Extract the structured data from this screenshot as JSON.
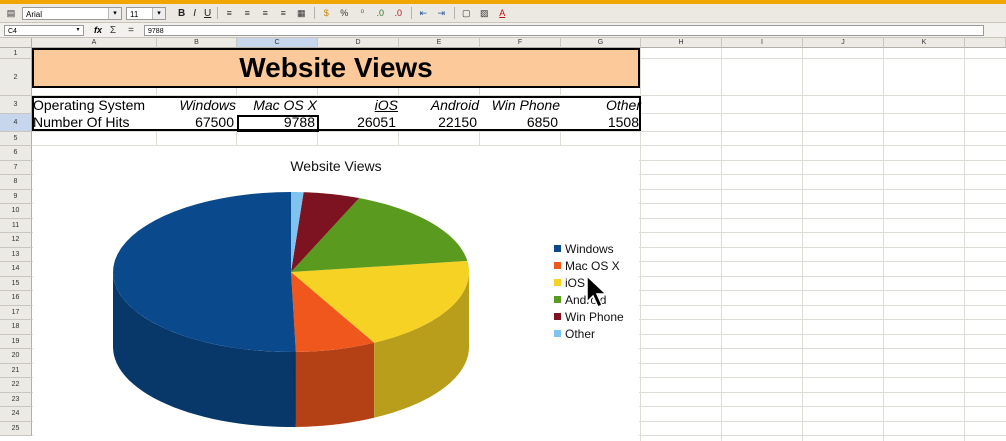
{
  "toolbar": {
    "font_name": "Arial",
    "font_size": "11",
    "bold": "B",
    "italic": "I",
    "underline": "U"
  },
  "formula_bar": {
    "cell_ref": "C4",
    "value": "9788"
  },
  "columns": [
    "A",
    "B",
    "C",
    "D",
    "E",
    "F",
    "G",
    "H",
    "I",
    "J",
    "K"
  ],
  "rows": [
    "1",
    "2",
    "3",
    "4",
    "5",
    "6",
    "7",
    "8",
    "9",
    "10",
    "11",
    "12",
    "13",
    "14",
    "15",
    "16",
    "17",
    "18",
    "19",
    "20",
    "21",
    "22",
    "23",
    "24",
    "25"
  ],
  "sheet": {
    "title": "Website Views",
    "row_label_os": "Operating System",
    "row_label_hits": "Number Of Hits",
    "os_names": [
      "Windows",
      "Mac OS X",
      "iOS",
      "Android",
      "Win Phone",
      "Other"
    ],
    "hits": [
      "67500",
      "9788",
      "26051",
      "22150",
      "6850",
      "1508"
    ]
  },
  "chart_data": {
    "type": "pie",
    "title": "Website Views",
    "categories": [
      "Windows",
      "Mac OS X",
      "iOS",
      "Android",
      "Win Phone",
      "Other"
    ],
    "values": [
      67500,
      9788,
      26051,
      22150,
      6850,
      1508
    ],
    "colors": [
      "#0a4a8c",
      "#f0571d",
      "#f6d224",
      "#5a9a1e",
      "#7d1320",
      "#7ec4ef"
    ],
    "legend_position": "right",
    "style": "3d"
  }
}
